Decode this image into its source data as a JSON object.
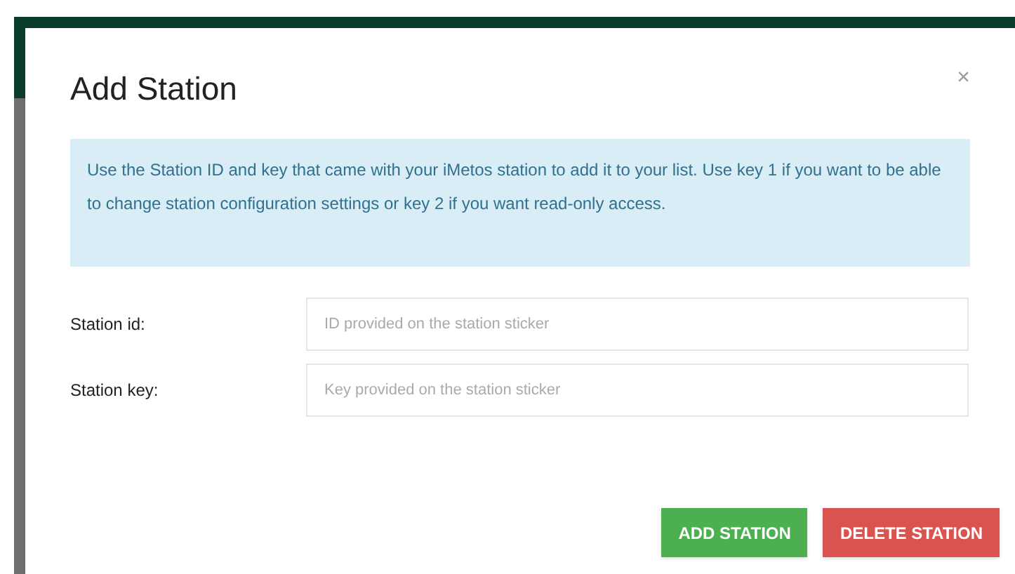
{
  "dialog": {
    "title": "Add Station",
    "close": "×",
    "info": "Use the Station ID and key that came with your iMetos station to add it to your list. Use key 1 if you want to be able to change station configuration settings or key 2 if you want read-only access.",
    "fields": [
      {
        "label": "Station id:",
        "placeholder": "ID provided on the station sticker"
      },
      {
        "label": "Station key:",
        "placeholder": "Key provided on the station sticker"
      }
    ],
    "buttons": [
      {
        "label": "ADD STATION",
        "kind": "primary"
      },
      {
        "label": "DELETE STATION",
        "kind": "danger"
      }
    ]
  }
}
